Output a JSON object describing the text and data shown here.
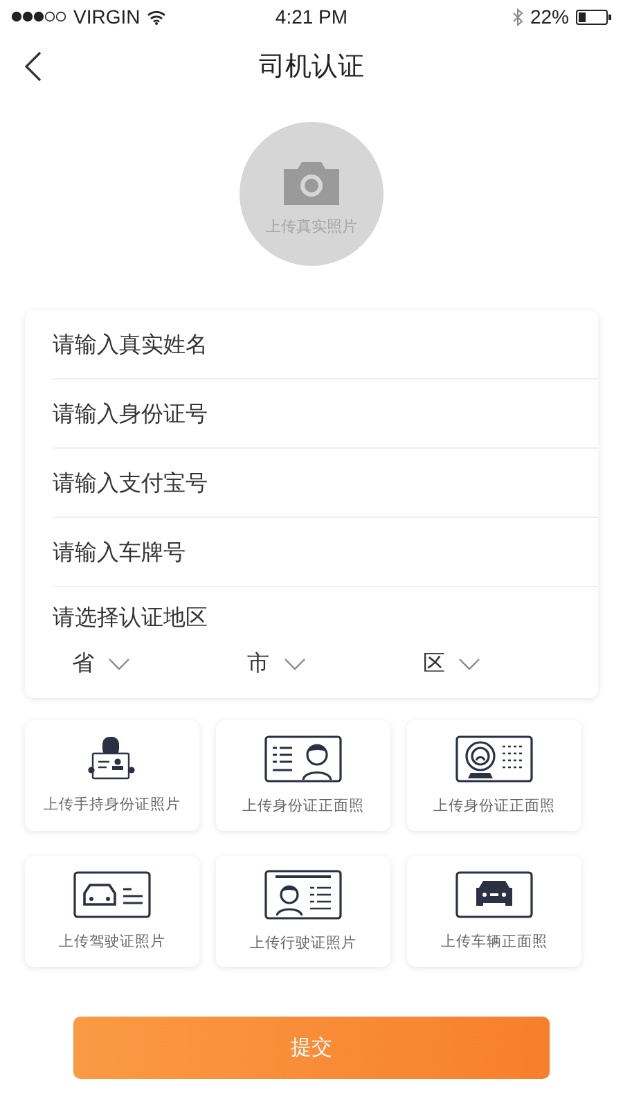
{
  "status_bar": {
    "carrier": "VIRGIN",
    "time": "4:21 PM",
    "battery": "22%"
  },
  "nav": {
    "title": "司机认证"
  },
  "avatar_upload": {
    "label": "上传真实照片"
  },
  "form": {
    "fields": [
      {
        "placeholder": "请输入真实姓名"
      },
      {
        "placeholder": "请输入身份证号"
      },
      {
        "placeholder": "请输入支付宝号"
      },
      {
        "placeholder": "请输入车牌号"
      }
    ],
    "region": {
      "label": "请选择认证地区",
      "selectors": [
        "省",
        "市",
        "区"
      ]
    }
  },
  "uploads": [
    {
      "kind": "holding-id",
      "label": "上传手持身份证照片"
    },
    {
      "kind": "id-front",
      "label": "上传身份证正面照"
    },
    {
      "kind": "id-emblem",
      "label": "上传身份证正面照"
    },
    {
      "kind": "driver-license",
      "label": "上传驾驶证照片"
    },
    {
      "kind": "vehicle-license",
      "label": "上传行驶证照片"
    },
    {
      "kind": "car-front",
      "label": "上传车辆正面照"
    }
  ],
  "submit": {
    "label": "提交"
  }
}
